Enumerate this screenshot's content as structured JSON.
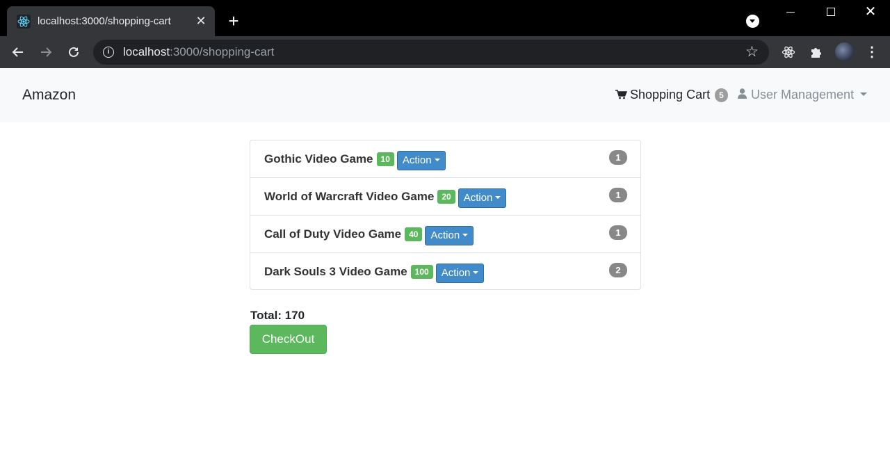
{
  "browser": {
    "tab_title": "localhost:3000/shopping-cart",
    "url_host": "localhost",
    "url_path": ":3000/shopping-cart"
  },
  "navbar": {
    "brand": "Amazon",
    "cart_label": "Shopping Cart",
    "cart_count": "5",
    "user_menu_label": "User Management"
  },
  "cart": {
    "items": [
      {
        "name": "Gothic Video Game",
        "price": "10",
        "action_label": "Action",
        "quantity": "1"
      },
      {
        "name": "World of Warcraft Video Game",
        "price": "20",
        "action_label": "Action",
        "quantity": "1"
      },
      {
        "name": "Call of Duty Video Game",
        "price": "40",
        "action_label": "Action",
        "quantity": "1"
      },
      {
        "name": "Dark Souls 3 Video Game",
        "price": "100",
        "action_label": "Action",
        "quantity": "2"
      }
    ],
    "total_label": "Total: 170",
    "checkout_label": "CheckOut"
  },
  "colors": {
    "success": "#5cb85c",
    "primary": "#428bca",
    "badge": "#888888",
    "navbar_bg": "#f8f9fa"
  }
}
